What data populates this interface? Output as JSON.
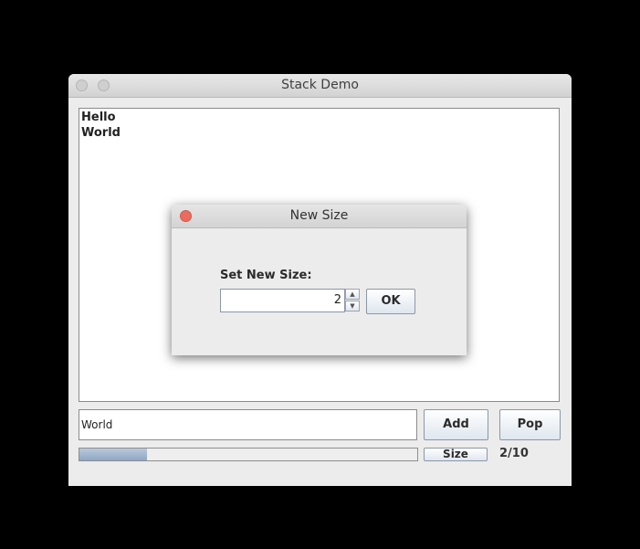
{
  "window": {
    "title": "Stack Demo"
  },
  "stack": {
    "items": [
      "Hello",
      "World"
    ]
  },
  "input": {
    "value": "World"
  },
  "buttons": {
    "add": "Add",
    "pop": "Pop",
    "size": "Size"
  },
  "progress": {
    "fraction": 0.2
  },
  "counter": {
    "text": "2/10"
  },
  "dialog": {
    "title": "New Size",
    "label": "Set New Size:",
    "spinner_value": "2",
    "ok": "OK"
  },
  "colors": {
    "close_button": "#ec6a5e",
    "progress_fill": "#8fa7c4"
  }
}
